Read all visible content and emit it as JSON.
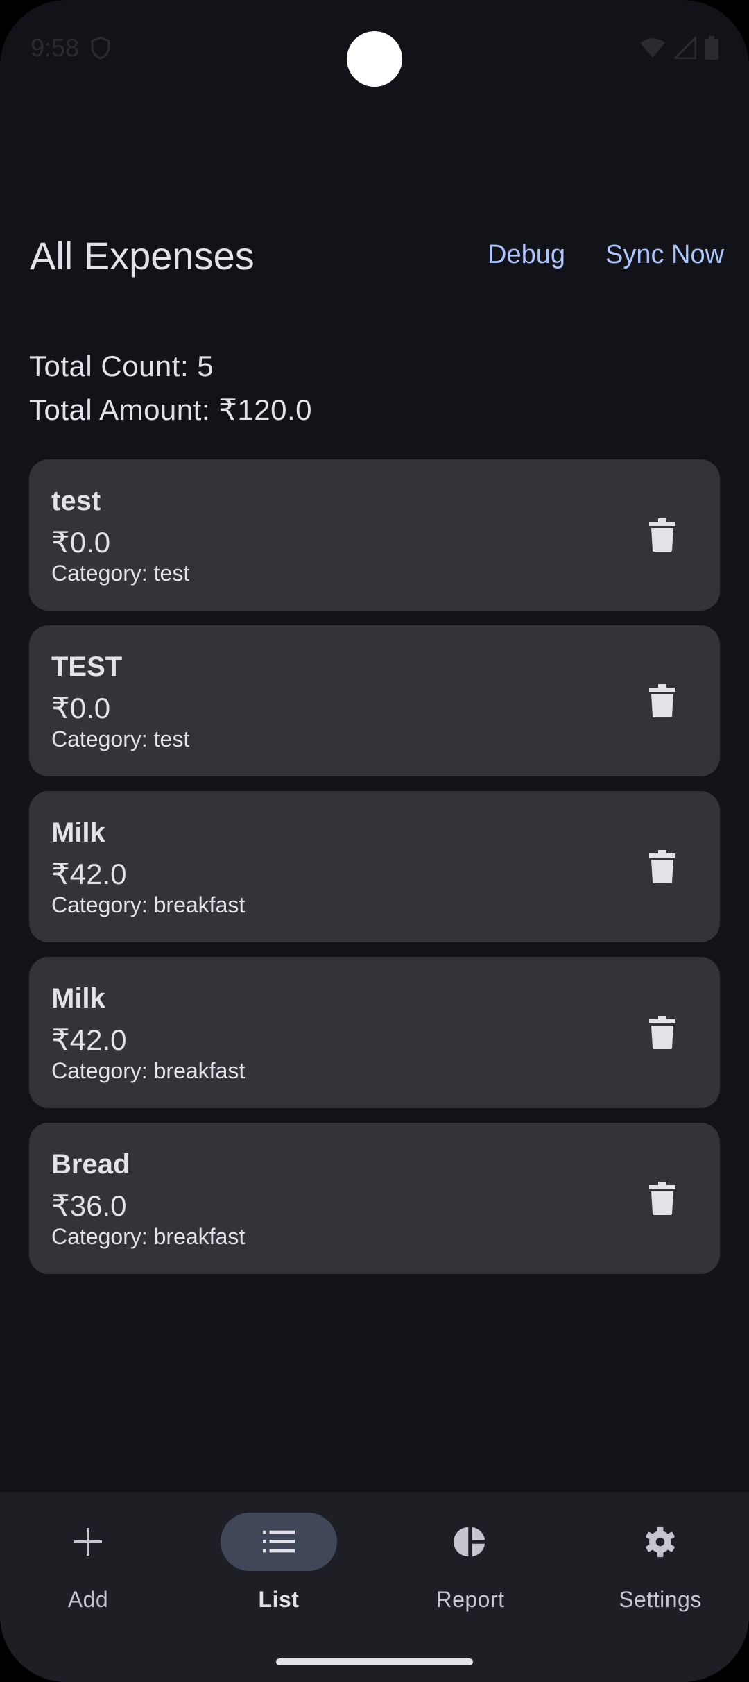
{
  "status_bar": {
    "time": "9:58",
    "icons": [
      "shield-icon",
      "wifi-icon",
      "signal-icon",
      "battery-icon"
    ]
  },
  "header": {
    "title": "All Expenses",
    "debug_label": "Debug",
    "sync_label": "Sync Now"
  },
  "totals": {
    "count_text": "Total Count: 5",
    "amount_text": "Total Amount: ₹120.0"
  },
  "expenses": [
    {
      "name": "test",
      "amount": "₹0.0",
      "category": "Category: test"
    },
    {
      "name": "TEST",
      "amount": "₹0.0",
      "category": "Category: test"
    },
    {
      "name": "Milk",
      "amount": "₹42.0",
      "category": "Category: breakfast"
    },
    {
      "name": "Milk",
      "amount": "₹42.0",
      "category": "Category: breakfast"
    },
    {
      "name": "Bread",
      "amount": "₹36.0",
      "category": "Category: breakfast"
    }
  ],
  "nav": {
    "items": [
      {
        "label": "Add",
        "icon": "plus-icon",
        "active": false
      },
      {
        "label": "List",
        "icon": "list-icon",
        "active": true
      },
      {
        "label": "Report",
        "icon": "pie-chart-icon",
        "active": false
      },
      {
        "label": "Settings",
        "icon": "gear-icon",
        "active": false
      }
    ]
  },
  "colors": {
    "background": "#121318",
    "card": "#33343a",
    "accent": "#adc6ff",
    "nav_background": "#1e1f25",
    "nav_indicator": "#3f4759"
  }
}
